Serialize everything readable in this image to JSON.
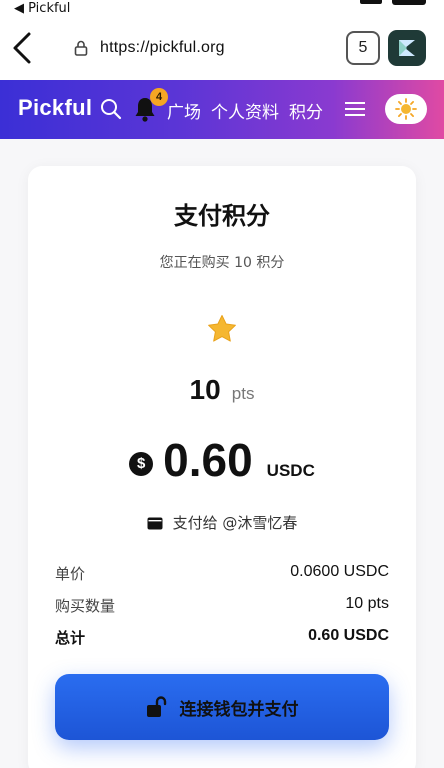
{
  "status_bar": {
    "back_app": "◀ Pickful"
  },
  "browser": {
    "url": "https://pickful.org",
    "tab_count": "5"
  },
  "nav": {
    "brand": "Pickful",
    "notification_count": "4",
    "links": [
      "广场",
      "个人资料",
      "积分"
    ]
  },
  "payment": {
    "title": "支付积分",
    "subtitle": "您正在购买 10 积分",
    "points_value": "10",
    "points_unit": "pts",
    "price_symbol": "$",
    "price": "0.60",
    "currency": "USDC",
    "pay_to": "支付给 @沐雪忆春",
    "summary": [
      {
        "label": "单价",
        "value": "0.0600 USDC"
      },
      {
        "label": "购买数量",
        "value": "10 pts"
      },
      {
        "label": "总计",
        "value": "0.60 USDC"
      }
    ],
    "button_label": "连接钱包并支付"
  },
  "colors": {
    "nav_gradient_start": "#3b2fd6",
    "nav_gradient_end": "#e04aa3",
    "button_blue": "#1d55d6",
    "star": "#f5b731",
    "badge": "#f5a623"
  }
}
